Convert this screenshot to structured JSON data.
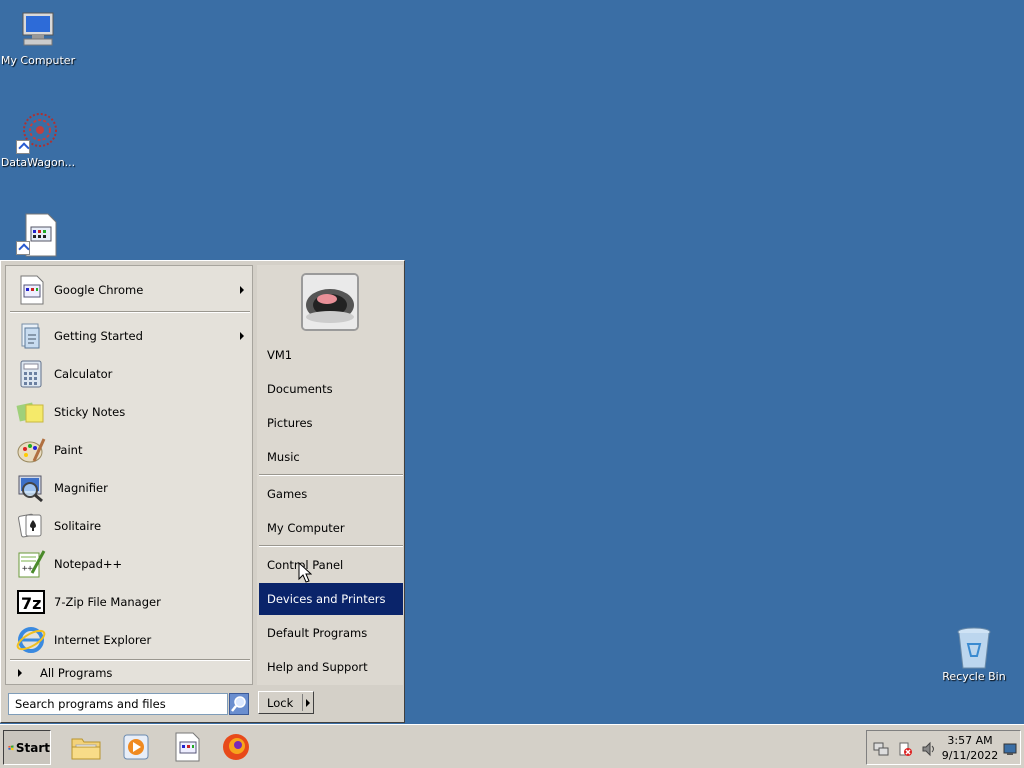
{
  "desktop": {
    "icons": [
      {
        "label": "My Computer"
      },
      {
        "label": "DataWagon..."
      },
      {
        "label": ""
      },
      {
        "label": "Recycle Bin"
      }
    ],
    "background_color": "#3a6ea5"
  },
  "start_menu": {
    "pinned": [
      {
        "label": "Google Chrome",
        "icon": "chrome-icon"
      }
    ],
    "programs": [
      {
        "label": "Getting Started",
        "icon": "getting-started-icon"
      },
      {
        "label": "Calculator",
        "icon": "calculator-icon"
      },
      {
        "label": "Sticky Notes",
        "icon": "sticky-notes-icon"
      },
      {
        "label": "Paint",
        "icon": "paint-icon"
      },
      {
        "label": "Magnifier",
        "icon": "magnifier-icon"
      },
      {
        "label": "Solitaire",
        "icon": "solitaire-icon"
      },
      {
        "label": "Notepad++",
        "icon": "notepadpp-icon"
      },
      {
        "label": "7-Zip File Manager",
        "icon": "sevenzip-icon"
      },
      {
        "label": "Internet Explorer",
        "icon": "ie-icon"
      }
    ],
    "all_programs": "All Programs",
    "search_placeholder": "Search programs and files",
    "right": [
      {
        "label": "VM1"
      },
      {
        "label": "Documents"
      },
      {
        "label": "Pictures"
      },
      {
        "label": "Music"
      },
      {
        "label": "Games"
      },
      {
        "label": "My Computer"
      },
      {
        "label": "Control Panel"
      },
      {
        "label": "Devices and Printers"
      },
      {
        "label": "Default Programs"
      },
      {
        "label": "Help and Support"
      }
    ],
    "highlighted": "Devices and Printers",
    "lock_label": "Lock",
    "highlight_color": "#0a246a"
  },
  "taskbar": {
    "start_label": "Start",
    "clock_time": "3:57 AM",
    "clock_date": "9/11/2022"
  }
}
